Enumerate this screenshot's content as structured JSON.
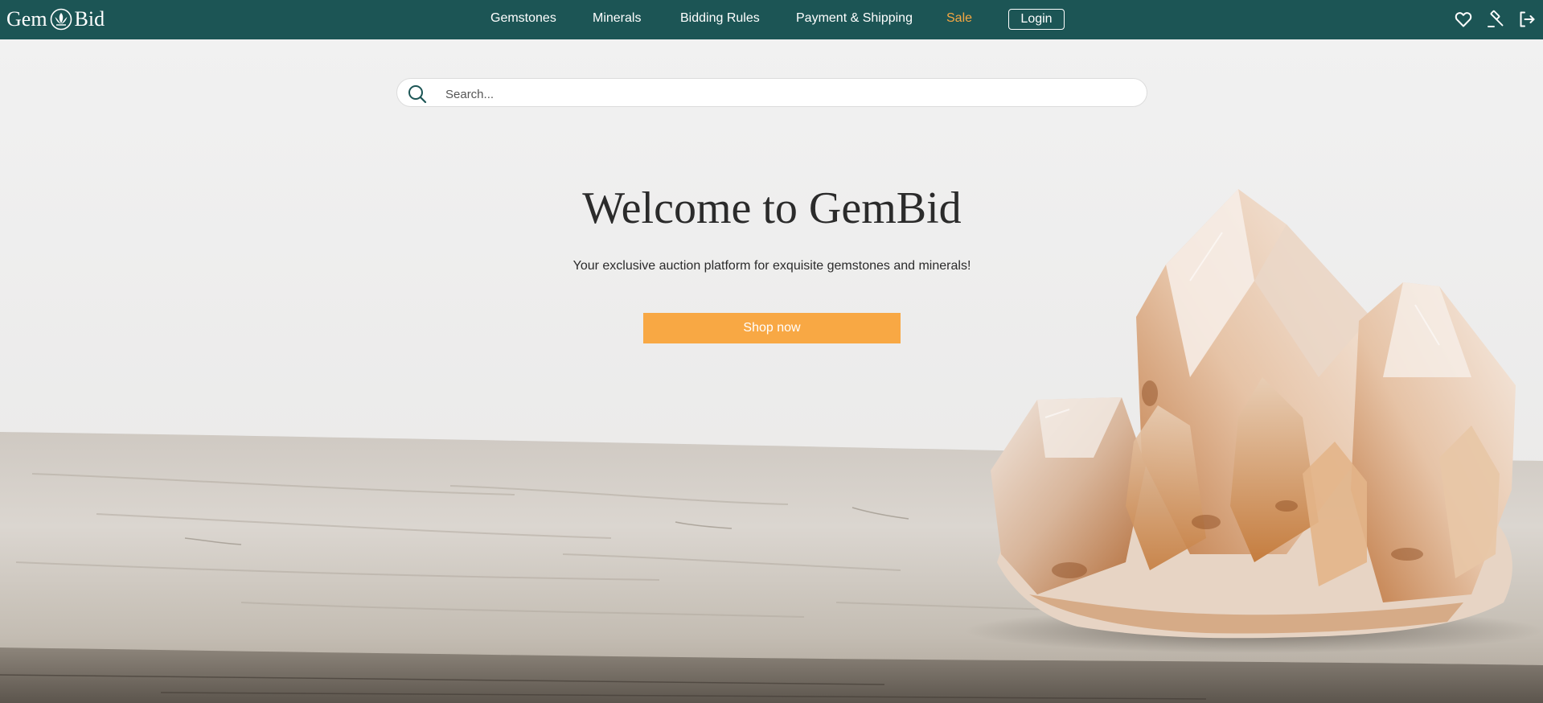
{
  "brand": {
    "name_left": "Gem",
    "name_right": "Bid",
    "logo_icon": "lotus-gem-icon"
  },
  "nav": {
    "links": [
      "Gemstones",
      "Minerals",
      "Bidding Rules",
      "Payment & Shipping",
      "Sale"
    ],
    "login_label": "Login",
    "icons": [
      "heart-icon",
      "gavel-icon",
      "logout-icon"
    ]
  },
  "search": {
    "placeholder": "Search...",
    "value": ""
  },
  "hero": {
    "title": "Welcome to GemBid",
    "subtitle": "Your exclusive auction platform for exquisite gemstones and minerals!",
    "cta_label": "Shop now",
    "image": "quartz-crystal-cluster-on-wooden-table"
  },
  "colors": {
    "nav_bg": "#1c5555",
    "accent": "#f8a844",
    "sale_link": "#f5a742",
    "text_dark": "#2b2b2b"
  }
}
